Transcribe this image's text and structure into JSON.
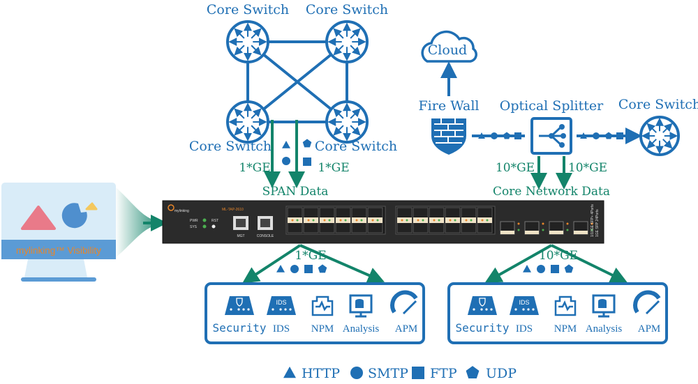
{
  "colors": {
    "blue": "#1f6fb4",
    "green": "#13846a",
    "device": "#2b2b2b",
    "orange": "#e8862a"
  },
  "span": {
    "switches": [
      "Core Switch",
      "Core Switch",
      "Core Switch",
      "Core Switch"
    ],
    "link_left": "1*GE",
    "link_right": "1*GE",
    "data_label": "SPAN Data"
  },
  "core": {
    "cloud": "Cloud",
    "firewall": "Fire Wall",
    "splitter": "Optical Splitter",
    "switch": "Core Switch",
    "link_left": "10*GE",
    "link_right": "10*GE",
    "data_label": "Core Network Data"
  },
  "device": {
    "brand": "mylinking",
    "model": "ML-TAP-2610",
    "pwr": "PWR",
    "sys": "SYS",
    "rst": "RST",
    "mgt": "MGT",
    "console": "CONSOLE",
    "side_label_1": "1/10GE SFP+ 4Ports",
    "side_label_2": "1GE SFP 24Ports"
  },
  "monitor": {
    "label": "mylinking™ Visibility"
  },
  "outputs": [
    {
      "link": "1*GE",
      "tools": [
        "Security",
        "IDS",
        "NPM",
        "Analysis",
        "APM"
      ]
    },
    {
      "link": "10*GE",
      "tools": [
        "Security",
        "IDS",
        "NPM",
        "Analysis",
        "APM"
      ]
    }
  ],
  "ids_badge": "IDS",
  "legend": [
    {
      "shape": "triangle",
      "label": "HTTP"
    },
    {
      "shape": "circle",
      "label": "SMTP"
    },
    {
      "shape": "square",
      "label": "FTP"
    },
    {
      "shape": "pentagon",
      "label": "UDP"
    }
  ]
}
